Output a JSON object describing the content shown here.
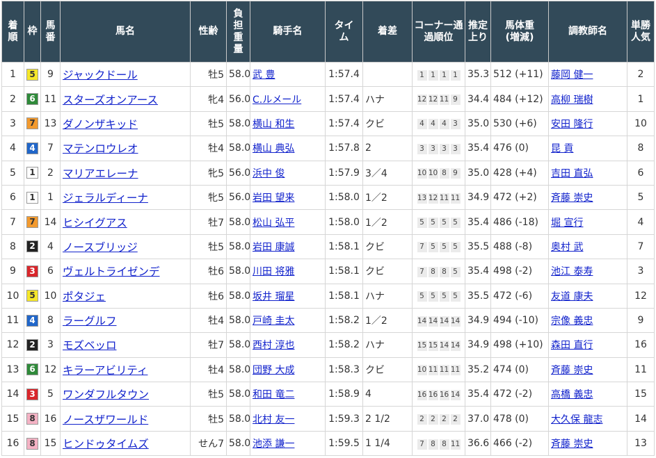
{
  "colors": {
    "header_bg": "#324a59",
    "link": "#1122cc",
    "waku": {
      "1": {
        "bg": "#ffffff",
        "fg": "#333333"
      },
      "2": {
        "bg": "#222222",
        "fg": "#ffffff"
      },
      "3": {
        "bg": "#d9262b",
        "fg": "#ffffff"
      },
      "4": {
        "bg": "#2066c9",
        "fg": "#ffffff"
      },
      "5": {
        "bg": "#f5e72a",
        "fg": "#333333"
      },
      "6": {
        "bg": "#2f8a3a",
        "fg": "#ffffff"
      },
      "7": {
        "bg": "#f29a2e",
        "fg": "#333333"
      },
      "8": {
        "bg": "#f4b2c4",
        "fg": "#333333"
      }
    }
  },
  "headers": {
    "rank": "着順",
    "waku": "枠",
    "umaban": "馬番",
    "horse": "馬名",
    "sexage": "性齢",
    "weight": "負担重量",
    "jockey": "騎手名",
    "time": "タイム",
    "margin": "着差",
    "corner": "コーナー通過順位",
    "last3f": "推定上り",
    "body": "馬体重(増減)",
    "trainer": "調教師名",
    "pop": "単勝人気"
  },
  "rows": [
    {
      "rank": "1",
      "waku": "5",
      "umaban": "9",
      "horse": "ジャックドール",
      "sexage": "牡5",
      "weight": "58.0",
      "jockey": "武 豊",
      "time": "1:57.4",
      "margin": "",
      "corner": [
        "1",
        "1",
        "1",
        "1"
      ],
      "last3f": "35.3",
      "body": "512 (+11)",
      "trainer": "藤岡 健一",
      "pop": "2"
    },
    {
      "rank": "2",
      "waku": "6",
      "umaban": "11",
      "horse": "スターズオンアース",
      "sexage": "牝4",
      "weight": "56.0",
      "jockey": "C.ルメール",
      "time": "1:57.4",
      "margin": "ハナ",
      "corner": [
        "12",
        "12",
        "11",
        "9"
      ],
      "last3f": "34.4",
      "body": "484 (+12)",
      "trainer": "高柳 瑞樹",
      "pop": "1"
    },
    {
      "rank": "3",
      "waku": "7",
      "umaban": "13",
      "horse": "ダノンザキッド",
      "sexage": "牡5",
      "weight": "58.0",
      "jockey": "横山 和生",
      "time": "1:57.4",
      "margin": "クビ",
      "corner": [
        "4",
        "4",
        "4",
        "3"
      ],
      "last3f": "35.0",
      "body": "530 (+6)",
      "trainer": "安田 隆行",
      "pop": "10"
    },
    {
      "rank": "4",
      "waku": "4",
      "umaban": "7",
      "horse": "マテンロウレオ",
      "sexage": "牡4",
      "weight": "58.0",
      "jockey": "横山 典弘",
      "time": "1:57.8",
      "margin": "2",
      "corner": [
        "3",
        "3",
        "3",
        "3"
      ],
      "last3f": "35.4",
      "body": "476 (0)",
      "trainer": "昆 貢",
      "pop": "8"
    },
    {
      "rank": "5",
      "waku": "1",
      "umaban": "2",
      "horse": "マリアエレーナ",
      "sexage": "牝5",
      "weight": "56.0",
      "jockey": "浜中 俊",
      "time": "1:57.9",
      "margin": "3／4",
      "corner": [
        "10",
        "10",
        "8",
        "9"
      ],
      "last3f": "35.0",
      "body": "428 (+4)",
      "trainer": "吉田 直弘",
      "pop": "6"
    },
    {
      "rank": "6",
      "waku": "1",
      "umaban": "1",
      "horse": "ジェラルディーナ",
      "sexage": "牝5",
      "weight": "56.0",
      "jockey": "岩田 望来",
      "time": "1:58.0",
      "margin": "1／2",
      "corner": [
        "13",
        "12",
        "11",
        "11"
      ],
      "last3f": "34.9",
      "body": "472 (+2)",
      "trainer": "斉藤 崇史",
      "pop": "5"
    },
    {
      "rank": "7",
      "waku": "7",
      "umaban": "14",
      "horse": "ヒシイグアス",
      "sexage": "牡7",
      "weight": "58.0",
      "jockey": "松山 弘平",
      "time": "1:58.0",
      "margin": "1／2",
      "corner": [
        "5",
        "5",
        "5",
        "5"
      ],
      "last3f": "35.4",
      "body": "486 (-18)",
      "trainer": "堀 宣行",
      "pop": "4"
    },
    {
      "rank": "8",
      "waku": "2",
      "umaban": "4",
      "horse": "ノースブリッジ",
      "sexage": "牡5",
      "weight": "58.0",
      "jockey": "岩田 康誠",
      "time": "1:58.1",
      "margin": "クビ",
      "corner": [
        "7",
        "5",
        "5",
        "5"
      ],
      "last3f": "35.5",
      "body": "488 (-8)",
      "trainer": "奥村 武",
      "pop": "7"
    },
    {
      "rank": "9",
      "waku": "3",
      "umaban": "6",
      "horse": "ヴェルトライゼンデ",
      "sexage": "牡6",
      "weight": "58.0",
      "jockey": "川田 将雅",
      "time": "1:58.1",
      "margin": "クビ",
      "corner": [
        "7",
        "8",
        "8",
        "5"
      ],
      "last3f": "35.4",
      "body": "498 (-2)",
      "trainer": "池江 泰寿",
      "pop": "3"
    },
    {
      "rank": "10",
      "waku": "5",
      "umaban": "10",
      "horse": "ポタジェ",
      "sexage": "牡6",
      "weight": "58.0",
      "jockey": "坂井 瑠星",
      "time": "1:58.1",
      "margin": "ハナ",
      "corner": [
        "5",
        "5",
        "5",
        "5"
      ],
      "last3f": "35.5",
      "body": "472 (-6)",
      "trainer": "友道 康夫",
      "pop": "12"
    },
    {
      "rank": "11",
      "waku": "4",
      "umaban": "8",
      "horse": "ラーグルフ",
      "sexage": "牡4",
      "weight": "58.0",
      "jockey": "戸崎 圭太",
      "time": "1:58.2",
      "margin": "1／2",
      "corner": [
        "14",
        "14",
        "14",
        "14"
      ],
      "last3f": "34.9",
      "body": "494 (-10)",
      "trainer": "宗像 義忠",
      "pop": "9"
    },
    {
      "rank": "12",
      "waku": "2",
      "umaban": "3",
      "horse": "モズベッロ",
      "sexage": "牡7",
      "weight": "58.0",
      "jockey": "西村 淳也",
      "time": "1:58.2",
      "margin": "ハナ",
      "corner": [
        "15",
        "15",
        "14",
        "14"
      ],
      "last3f": "34.9",
      "body": "498 (+10)",
      "trainer": "森田 直行",
      "pop": "16"
    },
    {
      "rank": "13",
      "waku": "6",
      "umaban": "12",
      "horse": "キラーアビリティ",
      "sexage": "牡4",
      "weight": "58.0",
      "jockey": "団野 大成",
      "time": "1:58.3",
      "margin": "クビ",
      "corner": [
        "10",
        "11",
        "11",
        "11"
      ],
      "last3f": "35.2",
      "body": "474 (0)",
      "trainer": "斉藤 崇史",
      "pop": "11"
    },
    {
      "rank": "14",
      "waku": "3",
      "umaban": "5",
      "horse": "ワンダフルタウン",
      "sexage": "牡5",
      "weight": "58.0",
      "jockey": "和田 竜二",
      "time": "1:58.9",
      "margin": "4",
      "corner": [
        "16",
        "16",
        "16",
        "14"
      ],
      "last3f": "35.4",
      "body": "472 (-2)",
      "trainer": "高橋 義忠",
      "pop": "15"
    },
    {
      "rank": "15",
      "waku": "8",
      "umaban": "16",
      "horse": "ノースザワールド",
      "sexage": "牡5",
      "weight": "58.0",
      "jockey": "北村 友一",
      "time": "1:59.3",
      "margin": "2 1/2",
      "corner": [
        "2",
        "2",
        "2",
        "2"
      ],
      "last3f": "37.0",
      "body": "478 (0)",
      "trainer": "大久保 龍志",
      "pop": "14"
    },
    {
      "rank": "16",
      "waku": "8",
      "umaban": "15",
      "horse": "ヒンドゥタイムズ",
      "sexage": "せん7",
      "weight": "58.0",
      "jockey": "池添 謙一",
      "time": "1:59.5",
      "margin": "1 1/4",
      "corner": [
        "7",
        "8",
        "8",
        "11"
      ],
      "last3f": "36.6",
      "body": "466 (-2)",
      "trainer": "斉藤 崇史",
      "pop": "13"
    }
  ]
}
